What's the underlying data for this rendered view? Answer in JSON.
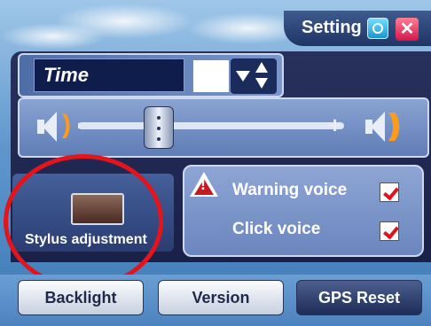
{
  "header": {
    "title": "Setting",
    "close_icon": "close-icon",
    "tools_icon": "tools-icon"
  },
  "time": {
    "label": "Time",
    "value": ""
  },
  "volume": {
    "level": 0.28
  },
  "voice": {
    "warning_label": "Warning voice",
    "warning_checked": true,
    "click_label": "Click voice",
    "click_checked": true
  },
  "stylus": {
    "label": "Stylus adjustment"
  },
  "buttons": {
    "backlight": "Backlight",
    "version": "Version",
    "gps_reset": "GPS Reset"
  },
  "colors": {
    "accent": "#e3151c",
    "panel": "#28315c",
    "sky": "#5f97cd"
  }
}
